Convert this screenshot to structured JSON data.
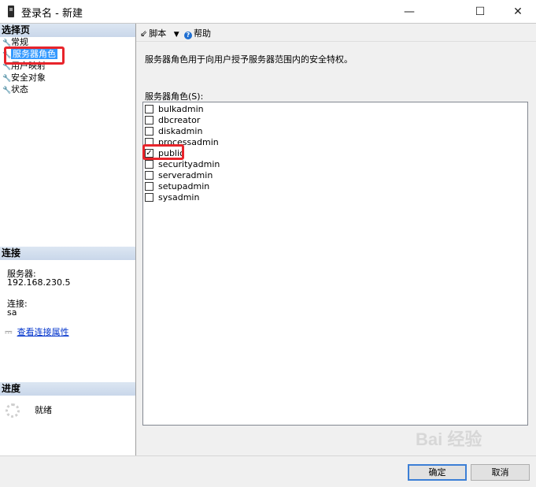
{
  "window": {
    "title": "登录名 - 新建",
    "minimize_glyph": "—",
    "maximize_glyph": "☐",
    "close_glyph": "✕"
  },
  "left": {
    "select_page_header": "选择页",
    "nav_items": [
      {
        "label": "常规",
        "selected": false
      },
      {
        "label": "服务器角色",
        "selected": true
      },
      {
        "label": "用户映射",
        "selected": false
      },
      {
        "label": "安全对象",
        "selected": false
      },
      {
        "label": "状态",
        "selected": false
      }
    ],
    "connection_header": "连接",
    "server_label": "服务器:",
    "server_value": "192.168.230.5",
    "connection_label": "连接:",
    "connection_value": "sa",
    "view_connection_link": "查看连接属性",
    "progress_header": "进度",
    "progress_status": "就绪"
  },
  "toolbar": {
    "script_label": "脚本",
    "help_label": "帮助"
  },
  "main": {
    "description": "服务器角色用于向用户授予服务器范围内的安全特权。",
    "roles_label": "服务器角色(S):",
    "roles": [
      {
        "name": "bulkadmin",
        "checked": false
      },
      {
        "name": "dbcreator",
        "checked": false
      },
      {
        "name": "diskadmin",
        "checked": false
      },
      {
        "name": "processadmin",
        "checked": false
      },
      {
        "name": "public",
        "checked": true
      },
      {
        "name": "securityadmin",
        "checked": false
      },
      {
        "name": "serveradmin",
        "checked": false
      },
      {
        "name": "setupadmin",
        "checked": false
      },
      {
        "name": "sysadmin",
        "checked": false
      }
    ]
  },
  "buttons": {
    "ok": "确定",
    "cancel": "取消"
  },
  "watermark": "Bai 经验",
  "colors": {
    "selection": "#3399ff",
    "highlight_box": "#e8242b",
    "link": "#0033cc"
  }
}
